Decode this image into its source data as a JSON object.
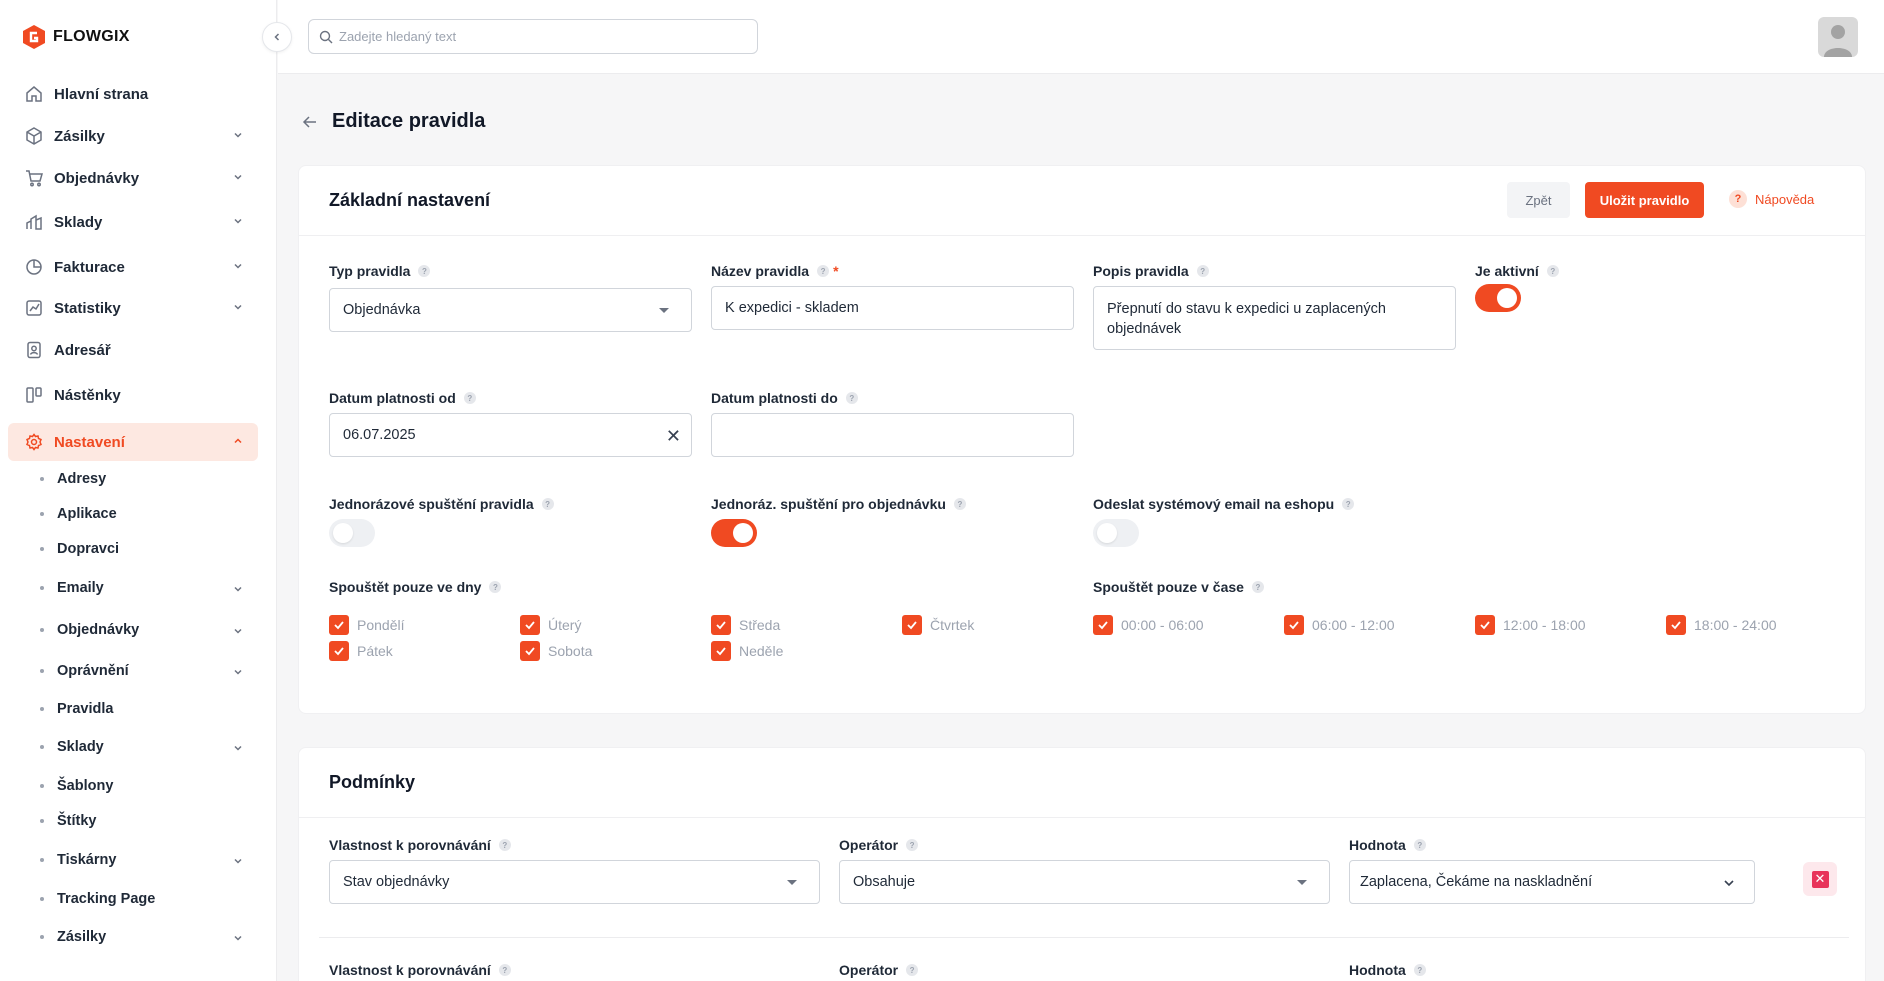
{
  "brand": {
    "name": "FLOWGIX",
    "accent": "#f04a22"
  },
  "search": {
    "placeholder": "Zadejte hledaný text"
  },
  "sidebar": {
    "items": [
      {
        "label": "Hlavní strana",
        "icon": "home-icon"
      },
      {
        "label": "Zásilky",
        "icon": "package-icon"
      },
      {
        "label": "Objednávky",
        "icon": "cart-icon"
      },
      {
        "label": "Sklady",
        "icon": "chart-icon"
      },
      {
        "label": "Fakturace",
        "icon": "pie-icon"
      },
      {
        "label": "Statistiky",
        "icon": "stats-icon"
      },
      {
        "label": "Adresář",
        "icon": "contact-icon"
      },
      {
        "label": "Nástěnky",
        "icon": "board-icon"
      },
      {
        "label": "Nastavení",
        "icon": "gear-icon"
      }
    ],
    "sub_items": [
      {
        "label": "Adresy"
      },
      {
        "label": "Aplikace"
      },
      {
        "label": "Dopravci"
      },
      {
        "label": "Emaily"
      },
      {
        "label": "Objednávky"
      },
      {
        "label": "Oprávnění"
      },
      {
        "label": "Pravidla"
      },
      {
        "label": "Sklady"
      },
      {
        "label": "Šablony"
      },
      {
        "label": "Štítky"
      },
      {
        "label": "Tiskárny"
      },
      {
        "label": "Tracking Page"
      },
      {
        "label": "Zásilky"
      }
    ]
  },
  "page": {
    "title": "Editace pravidla"
  },
  "basic": {
    "title": "Základní nastavení",
    "btn_back": "Zpět",
    "btn_save": "Uložit pravidlo",
    "btn_help": "Nápověda",
    "rule_type_label": "Typ pravidla",
    "rule_type_value": "Objednávka",
    "rule_name_label": "Název pravidla",
    "rule_name_required": "*",
    "rule_name_value": "K expedici - skladem",
    "description_label": "Popis pravidla",
    "description_value": "Přepnutí do stavu k expedici u zaplacených objednávek",
    "active_label": "Je aktivní",
    "valid_from_label": "Datum platnosti od",
    "valid_from_value": "06.07.2025",
    "valid_to_label": "Datum platnosti do",
    "valid_to_value": "",
    "one_time_label": "Jednorázové spuštění pravidla",
    "one_time_order_label": "Jednoráz. spuštění pro objednávku",
    "send_email_label": "Odeslat systémový email na eshopu",
    "days_label": "Spouštět pouze ve dny",
    "days": [
      "Pondělí",
      "Úterý",
      "Středa",
      "Čtvrtek",
      "Pátek",
      "Sobota",
      "Neděle"
    ],
    "times_label": "Spouštět pouze v čase",
    "times": [
      "00:00 - 06:00",
      "06:00 - 12:00",
      "12:00 - 18:00",
      "18:00 - 24:00"
    ]
  },
  "conditions": {
    "title": "Podmínky",
    "property_label": "Vlastnost k porovnávání",
    "property_value": "Stav objednávky",
    "operator_label": "Operátor",
    "operator_value": "Obsahuje",
    "value_label": "Hodnota",
    "value_value": "Zaplacena, Čekáme na naskladnění"
  }
}
